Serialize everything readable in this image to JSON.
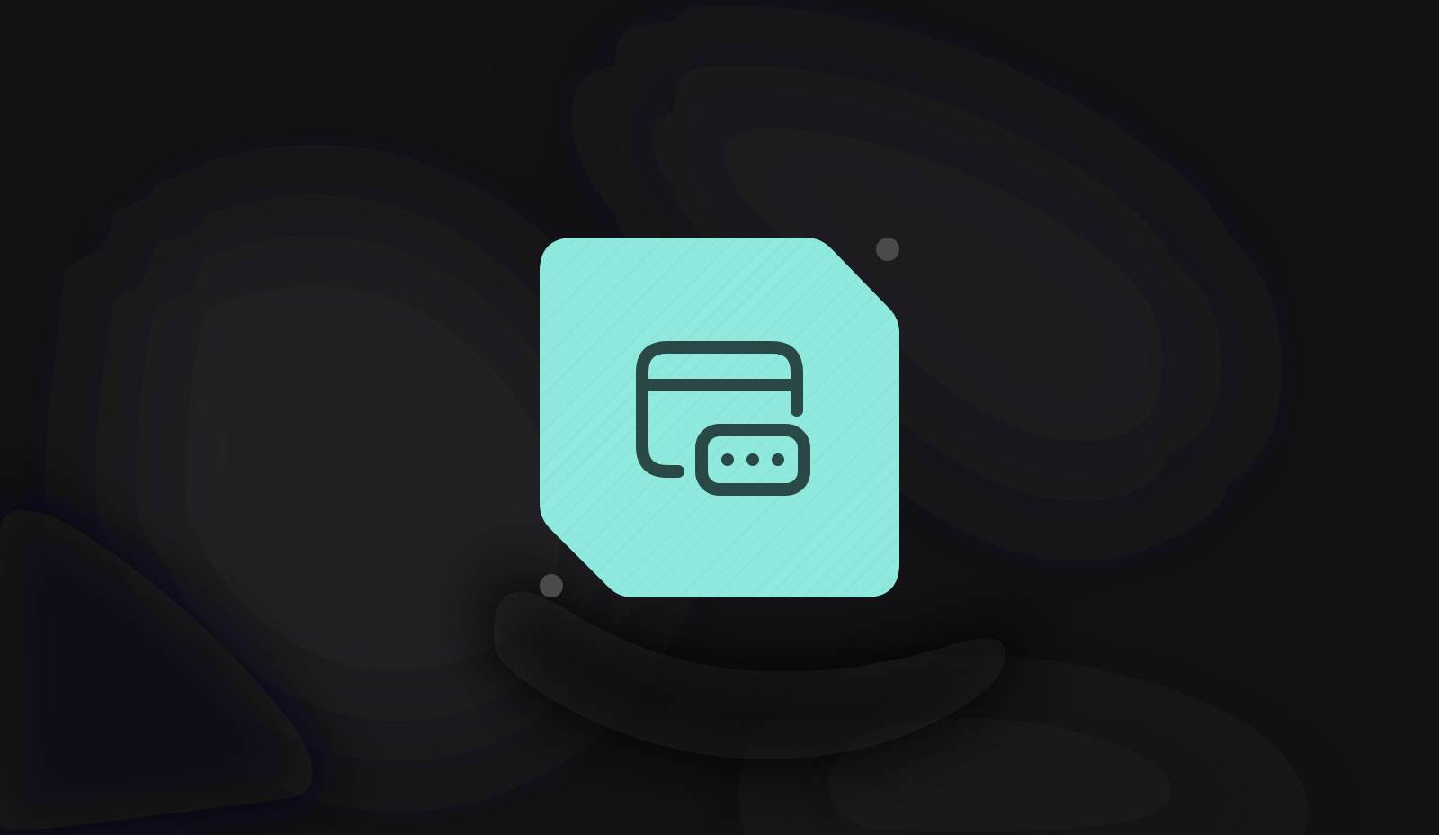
{
  "icon": {
    "name": "credit-card-password-icon",
    "glyph": "credit-card-with-password-dots",
    "password_dot_count": 3
  },
  "colors": {
    "background": "#131315",
    "tile": "#8fe9dc",
    "tile_stripe": "#7fd6ca",
    "glyph": "#2a4846",
    "corner_dot": "#4a4a4c"
  }
}
